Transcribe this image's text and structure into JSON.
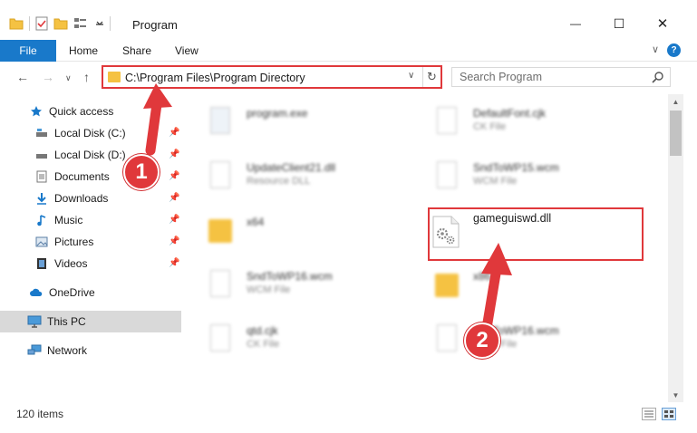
{
  "window": {
    "title": "Program",
    "minimize": "—",
    "maximize": "☐",
    "close": "✕"
  },
  "ribbon": {
    "tabs": [
      "File",
      "Home",
      "Share",
      "View"
    ],
    "help": "?"
  },
  "address_bar": {
    "path": "C:\\Program Files\\Program Directory"
  },
  "search": {
    "placeholder": "Search Program"
  },
  "sidebar": {
    "items": [
      {
        "label": "Quick access",
        "icon": "star-icon",
        "pinned": false
      },
      {
        "label": "Local Disk (C:)",
        "icon": "drive-icon",
        "pinned": true
      },
      {
        "label": "Local Disk (D:)",
        "icon": "drive-icon",
        "pinned": true
      },
      {
        "label": "Documents",
        "icon": "documents-icon",
        "pinned": true
      },
      {
        "label": "Downloads",
        "icon": "download-icon",
        "pinned": true
      },
      {
        "label": "Music",
        "icon": "music-icon",
        "pinned": true
      },
      {
        "label": "Pictures",
        "icon": "pictures-icon",
        "pinned": true
      },
      {
        "label": "Videos",
        "icon": "videos-icon",
        "pinned": true
      },
      {
        "label": "OneDrive",
        "icon": "cloud-icon",
        "pinned": false
      },
      {
        "label": "This PC",
        "icon": "computer-icon",
        "pinned": false,
        "selected": true
      },
      {
        "label": "Network",
        "icon": "network-icon",
        "pinned": false
      }
    ]
  },
  "files": [
    {
      "name": "program.exe",
      "type": ""
    },
    {
      "name": "DefaultFont.cjk",
      "type": "CK File"
    },
    {
      "name": "UpdateClient21.dll",
      "type": "Resource DLL"
    },
    {
      "name": "SndToWP15.wcm",
      "type": "WCM File"
    },
    {
      "name": "x64",
      "type": ""
    },
    {
      "name": "gameguiswd.dll",
      "type": ""
    },
    {
      "name": "SndToWP16.wcm",
      "type": "WCM File"
    },
    {
      "name": "x86",
      "type": ""
    },
    {
      "name": "qtd.cjk",
      "type": "CK File"
    },
    {
      "name": "SndToWP16.wcm",
      "type": "WCM File"
    }
  ],
  "status": {
    "item_count": "120 items"
  },
  "callouts": [
    "1",
    "2"
  ],
  "colors": {
    "accent": "#1979ca",
    "highlight": "#e0383b",
    "folder": "#f5c242",
    "selected": "#d9d9d9"
  }
}
